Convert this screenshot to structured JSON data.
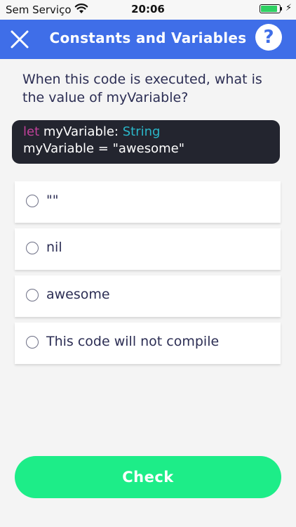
{
  "status_bar": {
    "carrier": "Sem Serviço",
    "time": "20:06",
    "battery_level": 0.95,
    "icons": [
      "wifi-icon",
      "battery-icon",
      "charging-bolt-icon"
    ]
  },
  "nav": {
    "title": "Constants and Variables",
    "close_icon": "close-icon",
    "help_label": "?",
    "background_color": "#3f6ee8"
  },
  "question": {
    "text": "When this code is executed, what is the value of myVariable?"
  },
  "code": {
    "line1": {
      "keyword": "let",
      "name": " myVariable: ",
      "type": "String"
    },
    "line2": "myVariable = \"awesome\""
  },
  "options": [
    {
      "label": "\"\"",
      "selected": false
    },
    {
      "label": "nil",
      "selected": false
    },
    {
      "label": "awesome",
      "selected": false
    },
    {
      "label": "This code will not compile",
      "selected": false
    }
  ],
  "check_button": {
    "label": "Check",
    "color": "#1ded88"
  }
}
